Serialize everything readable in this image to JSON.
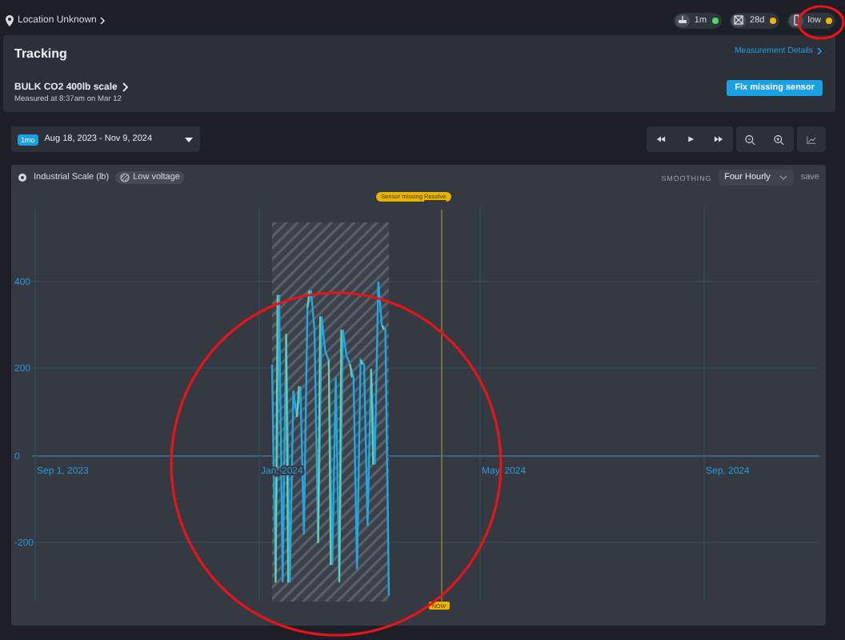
{
  "location": {
    "label": "Location Unknown"
  },
  "status_badges": [
    {
      "kind": "signal",
      "label": "1m",
      "color": "#4cd964"
    },
    {
      "kind": "calendar",
      "label": "28d",
      "color": "#f0b400"
    },
    {
      "kind": "battery",
      "label": "low",
      "color": "#f0b400"
    }
  ],
  "tracking": {
    "title": "Tracking",
    "details_link": "Measurement Details",
    "sensor_name": "BULK CO2 400lb scale",
    "measured": "Measured at 8:37am on Mar 12",
    "fix_button": "Fix missing sensor"
  },
  "range": {
    "badge": "1mo",
    "dates": "Aug 18, 2023 - Nov 9, 2024"
  },
  "chart": {
    "series_label": "Industrial Scale (lb)",
    "tags": [
      "Low voltage"
    ],
    "smoothing_label": "SMOOTHING",
    "smoothing": "Four Hourly",
    "save": "save",
    "sensor_missing": "Sensor missing",
    "resolve": "Resolve",
    "now": "NOW",
    "y_ticks": [
      "400",
      "200",
      "0",
      "-200"
    ],
    "x_ticks": [
      "Sep 1, 2023",
      "Jan, 2024",
      "May, 2024",
      "Sep, 2024"
    ]
  }
}
